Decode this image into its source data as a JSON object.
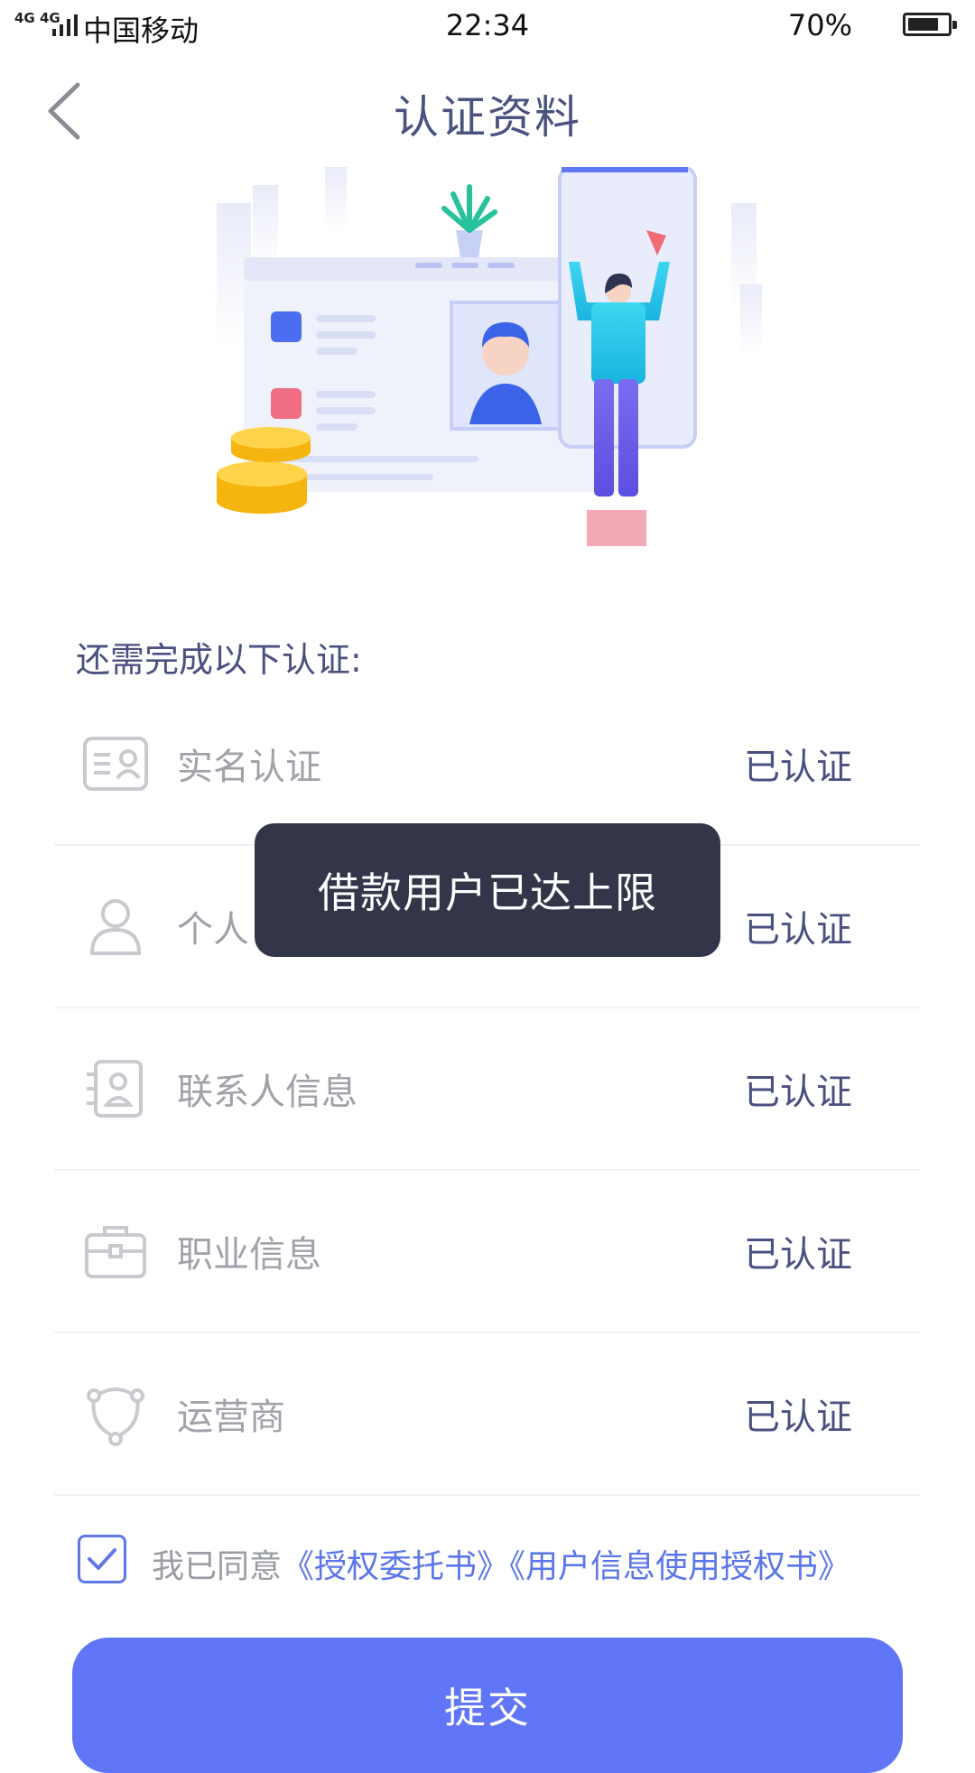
{
  "status_bar": {
    "network": "4G 4G",
    "carrier": "中国移动",
    "time": "22:34",
    "battery": "70%"
  },
  "header": {
    "title": "认证资料",
    "back_icon": "chevron-left-icon"
  },
  "section": {
    "heading": "还需完成以下认证:"
  },
  "items": [
    {
      "label": "实名认证",
      "status": "已认证",
      "icon": "id-card-icon"
    },
    {
      "label": "个人",
      "status": "已认证",
      "icon": "person-icon"
    },
    {
      "label": "联系人信息",
      "status": "已认证",
      "icon": "contact-card-icon"
    },
    {
      "label": "职业信息",
      "status": "已认证",
      "icon": "briefcase-icon"
    },
    {
      "label": "运营商",
      "status": "已认证",
      "icon": "carrier-network-icon"
    }
  ],
  "toast": {
    "message": "借款用户已达上限"
  },
  "agreement": {
    "checked": true,
    "prefix": "我已同意",
    "link1": "《授权委托书》",
    "link2": "《用户信息使用授权书》"
  },
  "submit": {
    "label": "提交"
  },
  "colors": {
    "accent": "#6076f6",
    "link": "#5b76ea",
    "title": "#4a5280",
    "toast_bg": "#333548"
  }
}
